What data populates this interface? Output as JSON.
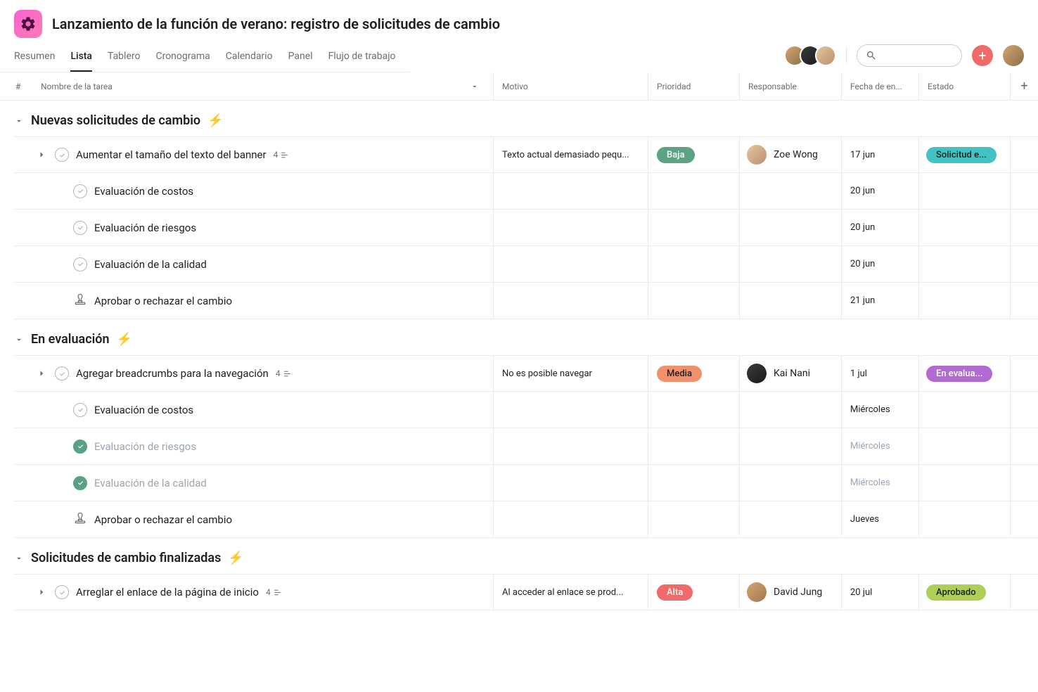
{
  "header": {
    "title": "Lanzamiento de la función de verano: registro de solicitudes de cambio"
  },
  "tabs": [
    "Resumen",
    "Lista",
    "Tablero",
    "Cronograma",
    "Calendario",
    "Panel",
    "Flujo de trabajo"
  ],
  "active_tab": 1,
  "columns": {
    "num": "#",
    "name": "Nombre de la tarea",
    "motivo": "Motivo",
    "prioridad": "Prioridad",
    "responsable": "Responsable",
    "fecha": "Fecha de en...",
    "estado": "Estado"
  },
  "sections": [
    {
      "title": "Nuevas solicitudes de cambio",
      "rows": [
        {
          "type": "parent",
          "name": "Aumentar el tamaño del texto del banner",
          "subtasks": "4",
          "motivo": "Texto actual demasiado pequ...",
          "prioridad": "Baja",
          "prio_class": "baja",
          "responsable": "Zoe Wong",
          "resp_class": "zoe",
          "fecha": "17 jun",
          "estado": "Solicitud e...",
          "estado_class": "solicitud"
        },
        {
          "type": "sub",
          "icon": "check",
          "name": "Evaluación de costos",
          "fecha": "20 jun"
        },
        {
          "type": "sub",
          "icon": "check",
          "name": "Evaluación de riesgos",
          "fecha": "20 jun"
        },
        {
          "type": "sub",
          "icon": "check",
          "name": "Evaluación de la calidad",
          "fecha": "20 jun"
        },
        {
          "type": "sub",
          "icon": "stamp",
          "name": "Aprobar o rechazar el cambio",
          "fecha": "21 jun"
        }
      ]
    },
    {
      "title": "En evaluación",
      "rows": [
        {
          "type": "parent",
          "name": "Agregar breadcrumbs para la navegación",
          "subtasks": "4",
          "motivo": "No es posible navegar",
          "prioridad": "Media",
          "prio_class": "media",
          "responsable": "Kai Nani",
          "resp_class": "kai",
          "fecha": "1 jul",
          "estado": "En evalua...",
          "estado_class": "evaluacion"
        },
        {
          "type": "sub",
          "icon": "check",
          "name": "Evaluación de costos",
          "fecha": "Miércoles"
        },
        {
          "type": "sub",
          "icon": "done",
          "name": "Evaluación de riesgos",
          "fecha": "Miércoles",
          "completed": true
        },
        {
          "type": "sub",
          "icon": "done",
          "name": "Evaluación de la calidad",
          "fecha": "Miércoles",
          "completed": true
        },
        {
          "type": "sub",
          "icon": "stamp",
          "name": "Aprobar o rechazar el cambio",
          "fecha": "Jueves"
        }
      ]
    },
    {
      "title": "Solicitudes de cambio finalizadas",
      "rows": [
        {
          "type": "parent",
          "name": "Arreglar el enlace de la página de inicio",
          "subtasks": "4",
          "motivo": "Al acceder al enlace se prod...",
          "prioridad": "Alta",
          "prio_class": "alta",
          "responsable": "David Jung",
          "resp_class": "david",
          "fecha": "20 jul",
          "estado": "Aprobado",
          "estado_class": "aprobado"
        }
      ]
    }
  ]
}
